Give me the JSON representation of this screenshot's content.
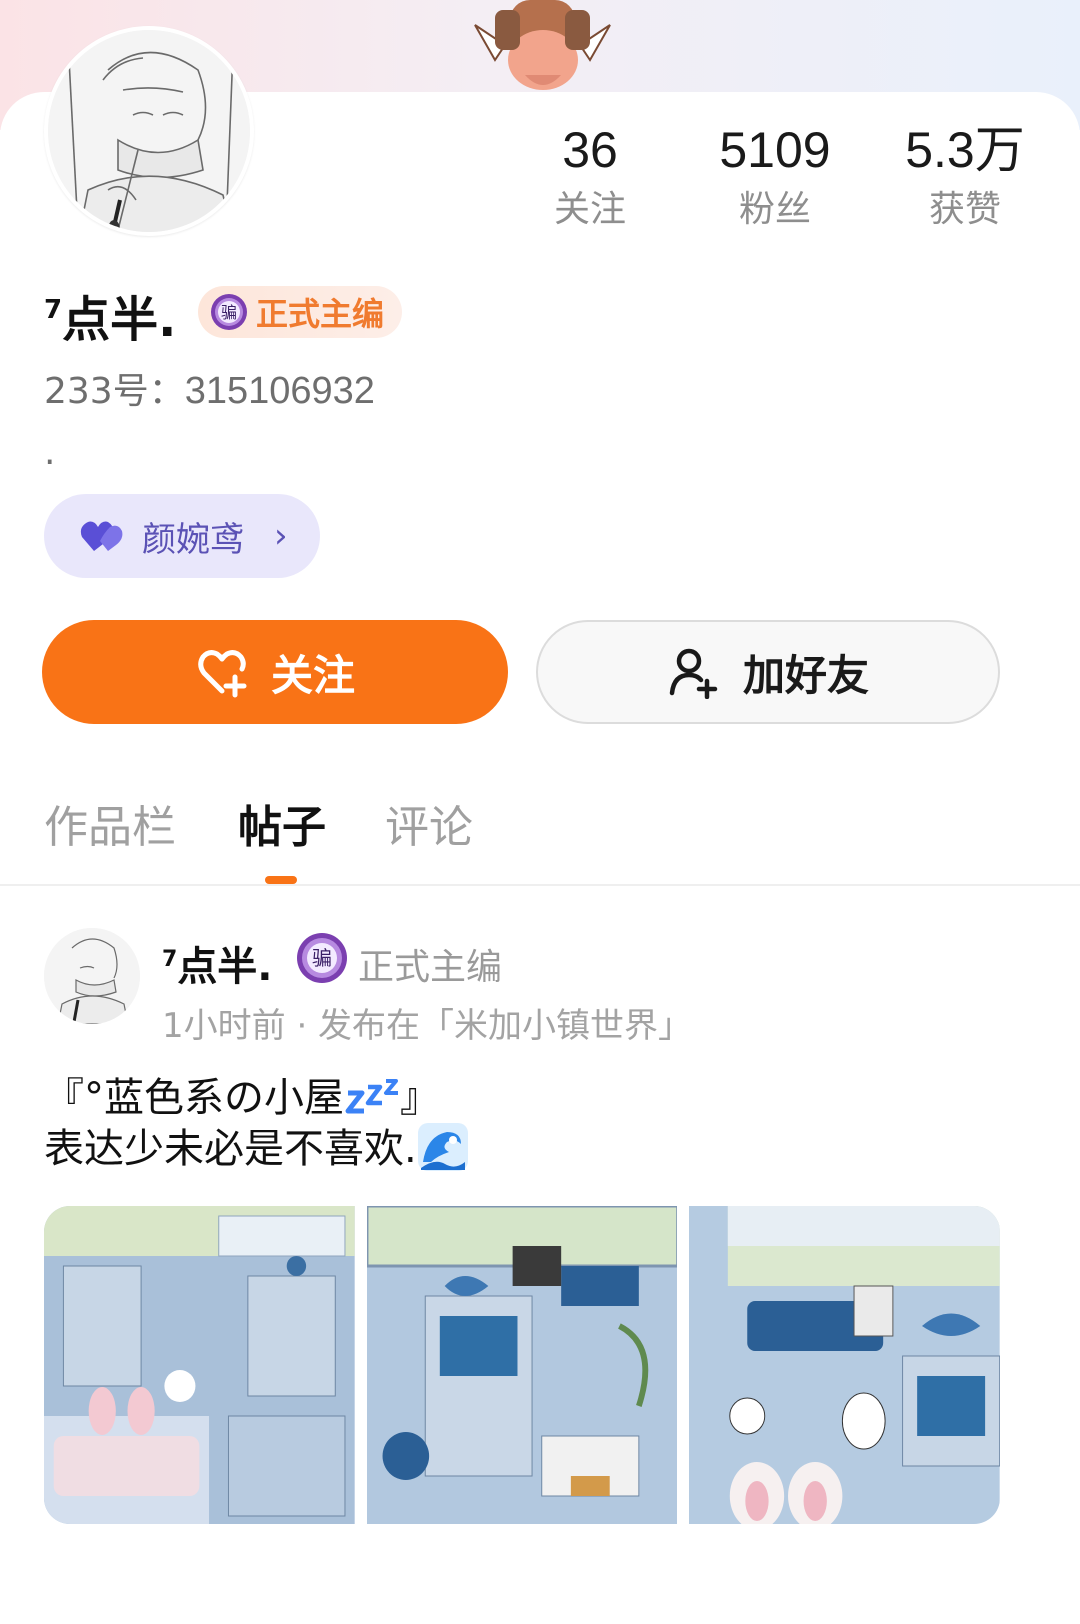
{
  "profile": {
    "name": "点半.",
    "name_prefix": "7",
    "rank_title": "正式主编",
    "rank_seal_char": "骗",
    "uid_label": "233号：",
    "uid_value": "315106932",
    "bio": ".",
    "partner_name": "颜婉鸢",
    "partner_chevron": "›"
  },
  "stats": [
    {
      "value": "36",
      "label": "关注"
    },
    {
      "value": "5109",
      "label": "粉丝"
    },
    {
      "value": "5.3万",
      "label": "获赞"
    }
  ],
  "actions": {
    "follow_label": "关注",
    "add_friend_label": "加好友"
  },
  "tabs": [
    {
      "label": "作品栏",
      "active": false
    },
    {
      "label": "帖子",
      "active": true
    },
    {
      "label": "评论",
      "active": false
    }
  ],
  "post": {
    "author": "点半.",
    "author_prefix": "7",
    "rank_title": "正式主编",
    "meta": "1小时前 · 发布在「米加小镇世界」",
    "title_text": "『°蓝色系の小屋",
    "title_end": "』",
    "body_text": "表达少未必是不喜欢.",
    "image_count": 3
  },
  "colors": {
    "accent": "#f97316",
    "rank_text": "#f07b2f",
    "pill_bg": "#e9e7fb",
    "pill_text": "#5b52b5",
    "muted": "#8e8e8e"
  },
  "icons": [
    "sketch-avatar",
    "rank-seal-icon",
    "purple-heart-icon",
    "chevron-right-icon",
    "heart-plus-icon",
    "add-person-icon",
    "zzz-emoji",
    "wave-emoji"
  ]
}
